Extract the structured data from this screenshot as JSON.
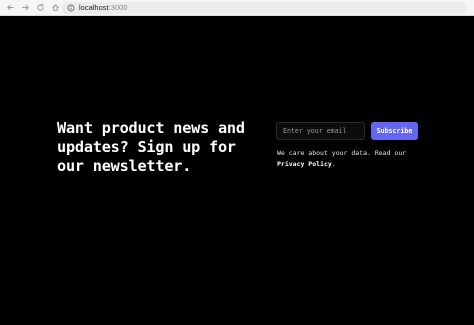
{
  "browser": {
    "url_host": "localhost",
    "url_port": ":3000"
  },
  "newsletter": {
    "headline": "Want product news and updates? Sign up for our newsletter.",
    "email_placeholder": "Enter your email",
    "subscribe_label": "Subscribe",
    "note_text": "We care about your data. Read our ",
    "privacy_link": "Privacy Policy",
    "note_end": "."
  },
  "colors": {
    "background": "#000000",
    "button": "#6366f1",
    "text": "#ffffff"
  }
}
